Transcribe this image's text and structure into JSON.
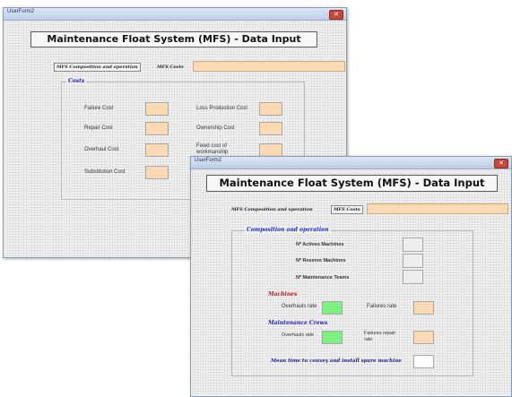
{
  "back_window": {
    "title": "UserForm2",
    "close_glyph": "✕",
    "header": "Maintenance Float System (MFS) - Data Input",
    "tabs": [
      "MFS Composition and operation",
      "MFS Costs"
    ],
    "section": "Costs",
    "left_fields": [
      "Failure Cost",
      "Repair Cost",
      "Overhaul Cost",
      "Substitution Cost"
    ],
    "right_fields": [
      "Loss Production Cost",
      "Ownership Cost",
      "Fixed cost of workmanship"
    ]
  },
  "front_window": {
    "title": "UserForm2",
    "close_glyph": "✕",
    "header": "Maintenance Float System (MFS) - Data Input",
    "tabs": [
      "MFS Composition and operation",
      "MFS Costs"
    ],
    "section": "Composition and operation",
    "fields": {
      "active_machines": "Nº Actives Machines",
      "reserve_machines": "Nº Reserve Machines",
      "maintenance_teams": "Nº Maintenance Teams"
    },
    "machines": {
      "legend": "Machines",
      "overhauls_rate": "Overhauls rate",
      "failures_rate": "Failures rate"
    },
    "crews": {
      "legend": "Maintenance Crews",
      "overhauls_rate": "Overhauls rate",
      "failures_repair_rate": "Failures repair rate"
    },
    "mean_time": "Mean time to convey and install spare machine"
  },
  "colors": {
    "input_peach": "#fbd9b3",
    "input_green": "#7ef07e",
    "legend_blue": "#2222bb",
    "legend_red": "#b3181c"
  }
}
